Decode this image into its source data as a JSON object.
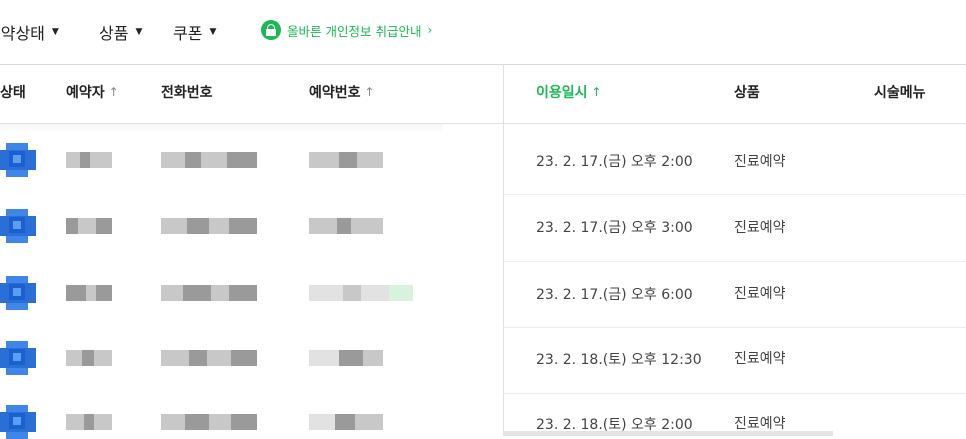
{
  "toolbar": {
    "filters": [
      {
        "label": "예약상태"
      },
      {
        "label": "상품"
      },
      {
        "label": "쿠폰"
      }
    ],
    "privacy_notice": "올바른 개인정보 취급안내",
    "privacy_arrow": "›"
  },
  "columns": {
    "status": "상태",
    "booker": "예약자",
    "phone": "전화번호",
    "reservation_no": "예약번호",
    "use_datetime": "이용일시",
    "product": "상품",
    "treatment_menu": "시술메뉴"
  },
  "sort_arrow": "↑",
  "accent_color": "#19b955",
  "status_icon_color": "#2a6fd6",
  "rows": [
    {
      "use_datetime": "23. 2. 17.(금) 오후 2:00",
      "product": "진료예약"
    },
    {
      "use_datetime": "23. 2. 17.(금) 오후 3:00",
      "product": "진료예약"
    },
    {
      "use_datetime": "23. 2. 17.(금) 오후 6:00",
      "product": "진료예약"
    },
    {
      "use_datetime": "23. 2. 18.(토) 오후 12:30",
      "product": "진료예약"
    },
    {
      "use_datetime": "23. 2. 18.(토) 오후 2:00",
      "product": "진료예약"
    }
  ]
}
